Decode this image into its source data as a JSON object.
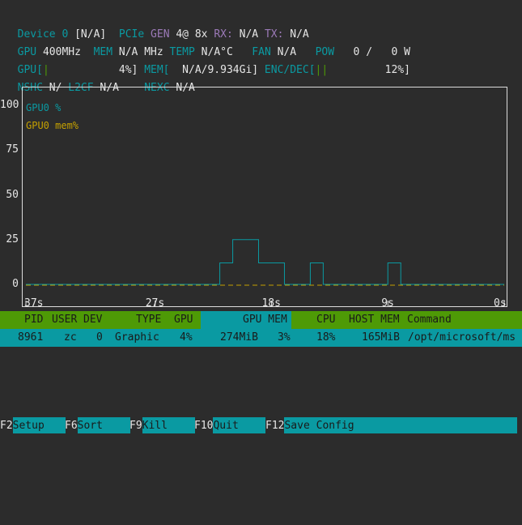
{
  "device": {
    "name_label": "Device 0",
    "name_value": "[N/A]",
    "pcie_label": "PCIe",
    "gen_label": "GEN",
    "gen_value": "4@ 8x",
    "rx_label": "RX:",
    "rx_value": "N/A",
    "tx_label": "TX:",
    "tx_value": "N/A"
  },
  "clocks": {
    "gpu_label": "GPU",
    "gpu_value": "400MHz",
    "mem_label": "MEM",
    "mem_value": "N/A MHz",
    "temp_label": "TEMP",
    "temp_value": "N/A°C",
    "fan_label": "FAN",
    "fan_value": "N/A",
    "pow_label": "POW",
    "pow_value": "0 /   0 W"
  },
  "bars": {
    "gpu_label": "GPU[",
    "gpu_value": "4%]",
    "gpu_fraction": 0.04,
    "mem_label": "MEM[",
    "mem_value": "N/A/9.934Gi]",
    "enc_label": "ENC/DEC[",
    "enc_value": "12%]",
    "enc_fraction": 0.12
  },
  "misc": {
    "nshc_label": "NSHC",
    "nshc_value": "N/",
    "l2cf_label": "L2CF",
    "l2cf_value": "N/A",
    "nexc_label": "NEXC",
    "nexc_value": "N/A"
  },
  "chart_data": {
    "type": "line",
    "yticks": [
      "100",
      "75",
      "50",
      "25",
      "0"
    ],
    "ylim": [
      0,
      100
    ],
    "xticks": [
      "37s",
      "27s",
      "18s",
      "9s",
      "0s"
    ],
    "x_seconds_ago": [
      37,
      36,
      35,
      34,
      33,
      32,
      31,
      30,
      29,
      28,
      27,
      26,
      25,
      24,
      23,
      22,
      21,
      20,
      19,
      18,
      17,
      16,
      15,
      14,
      13,
      12,
      11,
      10,
      9,
      8,
      7,
      6,
      5,
      4,
      3,
      2,
      1,
      0
    ],
    "series": [
      {
        "name": "GPU0 %",
        "color": "#0a9aa2",
        "values": [
          0,
          0,
          0,
          0,
          0,
          0,
          0,
          0,
          0,
          0,
          0,
          0,
          0,
          0,
          0,
          12,
          25,
          25,
          12,
          12,
          0,
          0,
          12,
          0,
          0,
          0,
          0,
          0,
          12,
          0,
          0,
          0,
          0,
          0,
          0,
          0,
          0,
          0
        ]
      },
      {
        "name": "GPU0 mem%",
        "color": "#c4a000",
        "values": [
          0,
          0,
          0,
          0,
          0,
          0,
          0,
          0,
          0,
          0,
          0,
          0,
          0,
          0,
          0,
          0,
          0,
          0,
          0,
          0,
          0,
          0,
          0,
          0,
          0,
          0,
          0,
          0,
          0,
          0,
          0,
          0,
          0,
          0,
          0,
          0,
          0,
          0
        ]
      }
    ]
  },
  "process_table": {
    "columns": [
      "PID",
      "USER",
      "DEV",
      "TYPE",
      "GPU",
      "GPU MEM",
      "CPU",
      "HOST MEM",
      "Command"
    ],
    "rows": [
      {
        "pid": "8961",
        "user": "zc",
        "dev": "0",
        "type": "Graphic",
        "gpu": "4%",
        "gpu_mem": "274MiB",
        "gpu_mem_pct": "3%",
        "cpu": "18%",
        "host_mem": "165MiB",
        "command": "/opt/microsoft/ms"
      }
    ]
  },
  "function_keys": [
    {
      "key": "F2",
      "label": "Setup"
    },
    {
      "key": "F6",
      "label": "Sort"
    },
    {
      "key": "F9",
      "label": "Kill"
    },
    {
      "key": "F10",
      "label": "Quit"
    },
    {
      "key": "F12",
      "label": "Save Config"
    }
  ]
}
